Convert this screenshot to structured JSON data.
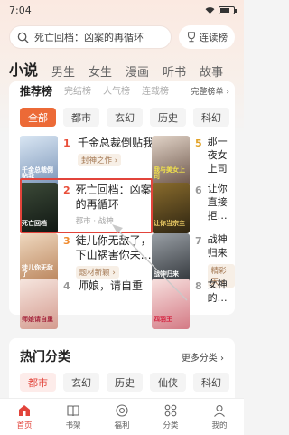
{
  "status": {
    "time": "7:04"
  },
  "search": {
    "text": "死亡回档：凶案的再循环",
    "rank_label": "连读榜"
  },
  "categories": [
    "小说",
    "男生",
    "女生",
    "漫画",
    "听书",
    "故事"
  ],
  "rank_tabs": [
    "推荐榜",
    "完结榜",
    "人气榜",
    "连载榜"
  ],
  "rank_more": "完整榜单 ›",
  "genres": [
    "全部",
    "都市",
    "玄幻",
    "历史",
    "科幻"
  ],
  "books": [
    {
      "rank": "1",
      "title": "千金总裁倒贴我",
      "tag": "封神之作 ›",
      "cover_text": "千金总裁倒贴我"
    },
    {
      "rank": "2",
      "title": "死亡回档：凶案的再循环",
      "tag": "都市 · 战神",
      "cover_text": "死亡回档"
    },
    {
      "rank": "3",
      "title": "徒儿你无敌了，下山祸害你未…",
      "tag": "题材新颖 ›",
      "cover_text": "徒儿你无敌了"
    },
    {
      "rank": "4",
      "title": "师娘，请自重",
      "tag": "",
      "cover_text": "师娘请自重"
    },
    {
      "rank": "5",
      "title": "那一夜女上司",
      "tag": "",
      "cover_text": "我与美女上司"
    },
    {
      "rank": "6",
      "title": "让你直接拒…",
      "tag": "",
      "cover_text": "让你当宗主"
    },
    {
      "rank": "7",
      "title": "战神归来",
      "tag": "精彩天 ›",
      "cover_text": "战神归来"
    },
    {
      "rank": "8",
      "title": "女神的…",
      "tag": "",
      "cover_text": "四羽王"
    }
  ],
  "hot": {
    "title": "热门分类",
    "more": "更多分类 ›",
    "genres": [
      "都市",
      "玄幻",
      "历史",
      "仙侠",
      "科幻"
    ]
  },
  "nav": [
    "首页",
    "书架",
    "福利",
    "分类",
    "我的"
  ]
}
